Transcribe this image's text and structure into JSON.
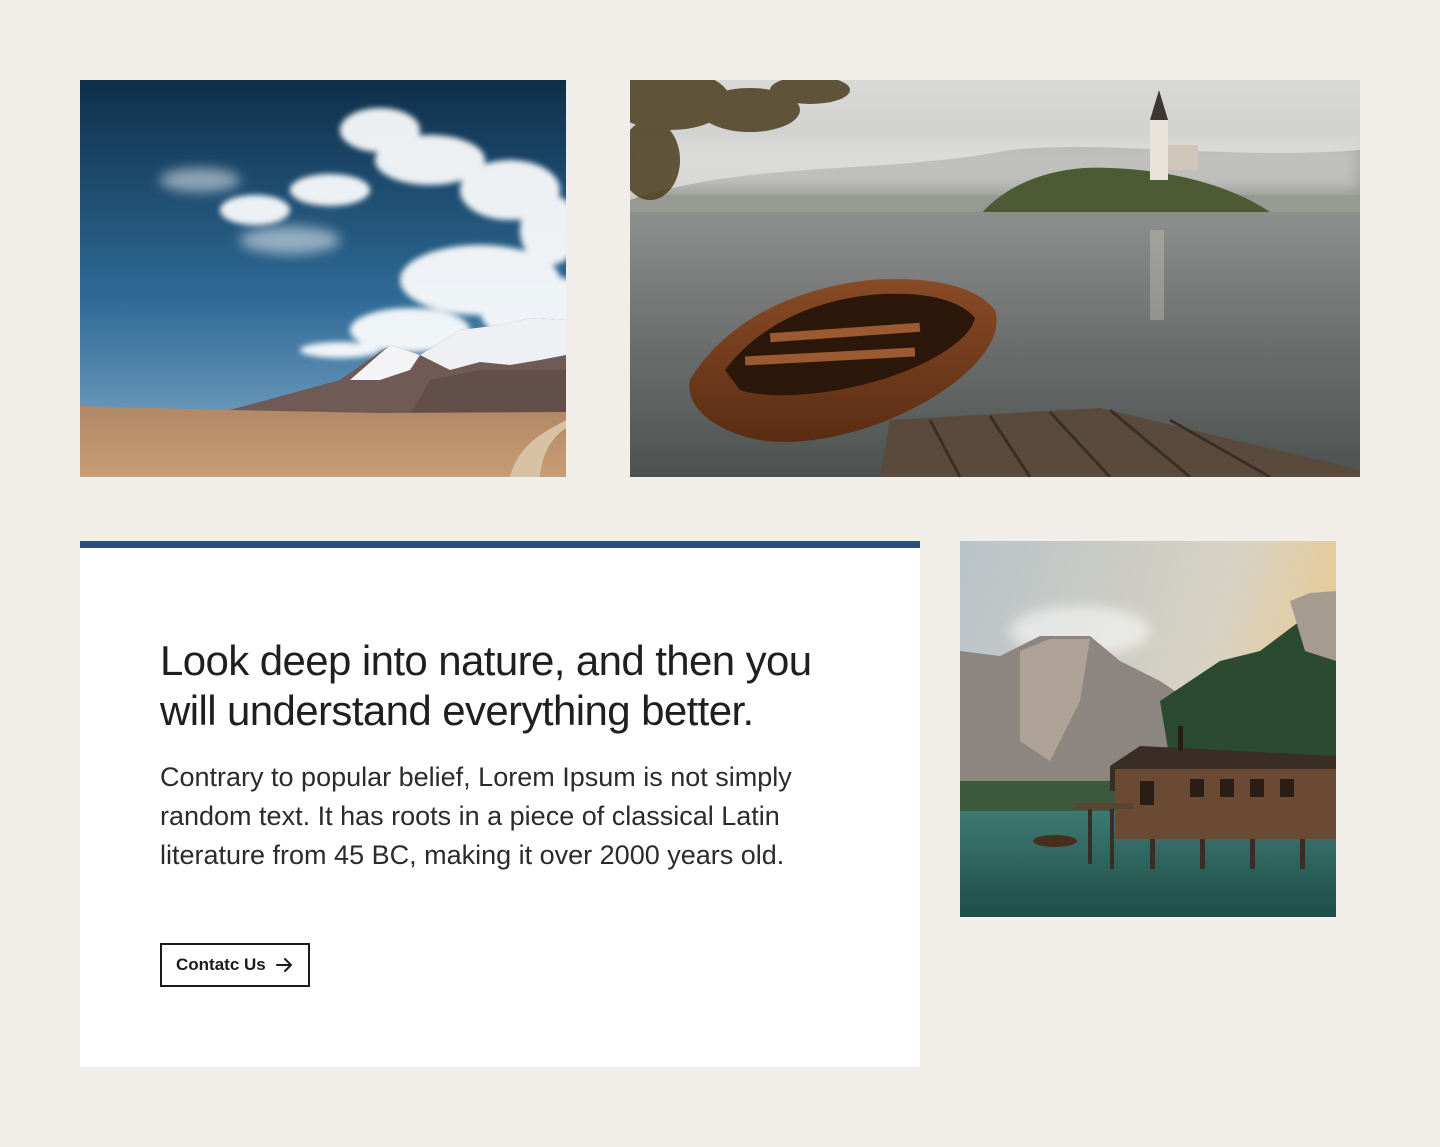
{
  "colors": {
    "background": "#f1ede9",
    "card": "#ffffff",
    "card_accent": "#2d4c86",
    "text": "#1f1f1f"
  },
  "gallery": {
    "photos": [
      {
        "subject": "desert-mountain-photo"
      },
      {
        "subject": "lake-boat-photo"
      },
      {
        "subject": "lake-cabin-photo"
      }
    ]
  },
  "card": {
    "title": "Look deep into nature, and then you will understand everything better.",
    "body": "Contrary to popular belief, Lorem Ipsum is not simply random text. It has roots in a piece of classical Latin literature from 45 BC, making it over 2000 years old.",
    "button_label": "Contatc Us",
    "button_icon": "arrow-right-icon"
  }
}
